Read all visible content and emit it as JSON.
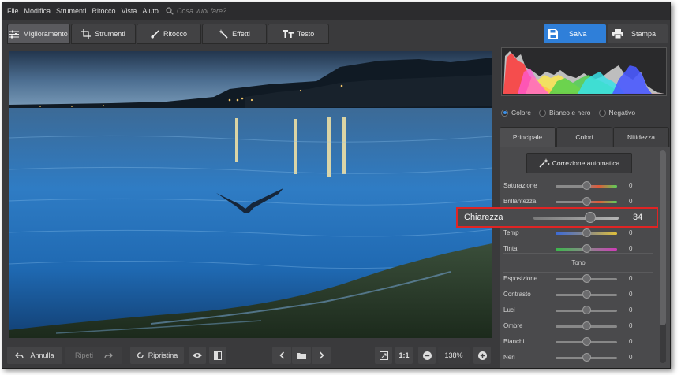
{
  "menu": {
    "items": [
      "File",
      "Modifica",
      "Strumenti",
      "Ritocco",
      "Vista",
      "Aiuto"
    ],
    "search_placeholder": "Cosa vuoi fare?"
  },
  "tool_tabs": [
    "Miglioramento",
    "Strumenti",
    "Ritocco",
    "Effetti",
    "Testo"
  ],
  "tool_tabs_active": "Miglioramento",
  "actions": {
    "save": "Salva",
    "print": "Stampa"
  },
  "color_modes": {
    "options": [
      "Colore",
      "Bianco e nero",
      "Negativo"
    ],
    "selected": "Colore"
  },
  "panel_tabs": [
    "Principale",
    "Colori",
    "Nitidezza"
  ],
  "panel_tabs_active": "Principale",
  "auto_correction": "Correzione automatica",
  "sliders": [
    {
      "label": "Saturazione",
      "value": "0",
      "level": 0.5,
      "gradient": "linear-gradient(90deg,#8a8a8a,#8a8a8a 45%,#e05a3a 70%,#5ad25a)"
    },
    {
      "label": "Brillantezza",
      "value": "0",
      "level": 0.5,
      "gradient": "linear-gradient(90deg,#8a8a8a,#8a8a8a 45%,#e05a3a 70%,#5ad25a)"
    },
    {
      "label": "Temp",
      "value": "0",
      "level": 0.5,
      "gradient": "linear-gradient(90deg,#3a6ad8,#8a8a8a 50%,#e0c03a)"
    },
    {
      "label": "Tinta",
      "value": "0",
      "level": 0.5,
      "gradient": "linear-gradient(90deg,#3ab84a,#8a8a8a 50%,#d03ab8)"
    }
  ],
  "highlighted_slider": {
    "label": "Chiarezza",
    "value": "34",
    "level": 0.67
  },
  "tone_section": {
    "title": "Tono",
    "sliders": [
      {
        "label": "Esposizione",
        "value": "0",
        "level": 0.5
      },
      {
        "label": "Contrasto",
        "value": "0",
        "level": 0.5
      },
      {
        "label": "Luci",
        "value": "0",
        "level": 0.5
      },
      {
        "label": "Ombre",
        "value": "0",
        "level": 0.5
      },
      {
        "label": "Bianchi",
        "value": "0",
        "level": 0.5
      },
      {
        "label": "Neri",
        "value": "0",
        "level": 0.5
      }
    ]
  },
  "bottom_bar": {
    "undo": "Annulla",
    "redo": "Ripeti",
    "reset": "Ripristina",
    "actual_size": "1:1",
    "zoom": "138%"
  },
  "icons": {
    "undo": "undo-icon",
    "redo": "redo-icon",
    "reset": "reset-icon",
    "preview": "eye-icon",
    "compare": "compare-icon",
    "prev": "chevron-left-icon",
    "folder": "folder-icon",
    "next": "chevron-right-icon",
    "fit": "fit-screen-icon",
    "zoom_out": "zoom-out-icon",
    "zoom_in": "zoom-in-icon",
    "save": "save-icon",
    "print": "printer-icon",
    "search": "search-icon"
  },
  "colors": {
    "accent": "#2f7fd9",
    "highlight_border": "#e02424",
    "panel": "#4a4a4c",
    "window": "#3a3a3c"
  }
}
